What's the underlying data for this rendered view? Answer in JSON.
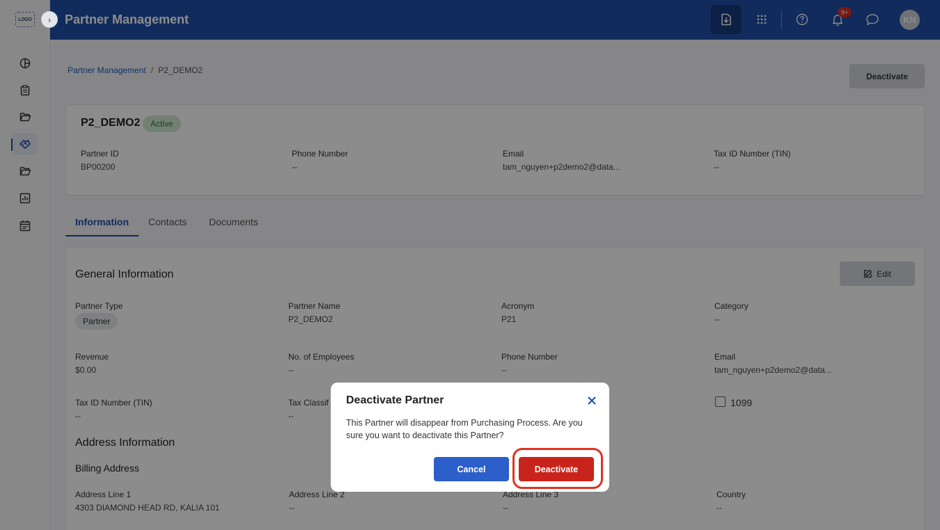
{
  "app": {
    "logo_text": "LOGO",
    "title": "Partner Management",
    "notification_count": "9+",
    "avatar_initials": "KN"
  },
  "sidebar": {
    "items": [
      {
        "icon": "pie-chart-icon"
      },
      {
        "icon": "clipboard-icon"
      },
      {
        "icon": "folder-open-icon"
      },
      {
        "icon": "handshake-icon",
        "active": true
      },
      {
        "icon": "folder-icon"
      },
      {
        "icon": "bar-chart-icon"
      },
      {
        "icon": "calendar-icon"
      }
    ]
  },
  "breadcrumb": {
    "root": "Partner Management",
    "separator": "/",
    "current": "P2_DEMO2"
  },
  "actions": {
    "deactivate_label": "Deactivate"
  },
  "partner": {
    "name": "P2_DEMO2",
    "status": "Active",
    "summary_fields": [
      {
        "label": "Partner ID",
        "value": "BP00200"
      },
      {
        "label": "Phone Number",
        "value": "--"
      },
      {
        "label": "Email",
        "value": "tam_nguyen+p2demo2@data..."
      },
      {
        "label": "Tax ID Number (TIN)",
        "value": "--"
      }
    ]
  },
  "tabs": [
    {
      "label": "Information",
      "active": true
    },
    {
      "label": "Contacts"
    },
    {
      "label": "Documents"
    }
  ],
  "general_info": {
    "title": "General Information",
    "edit_label": "Edit",
    "fields": [
      {
        "label": "Partner Type",
        "value": "Partner"
      },
      {
        "label": "Partner Name",
        "value": "P2_DEMO2"
      },
      {
        "label": "Acronym",
        "value": "P21"
      },
      {
        "label": "Category",
        "value": "--"
      },
      {
        "label": "Revenue",
        "value": "$0.00"
      },
      {
        "label": "No. of Employees",
        "value": "--"
      },
      {
        "label": "Phone Number",
        "value": "--"
      },
      {
        "label": "Email",
        "value": "tam_nguyen+p2demo2@data..."
      },
      {
        "label": "Tax ID Number (TIN)",
        "value": "--"
      },
      {
        "label": "Tax Classif",
        "value": "--"
      },
      {
        "label": "1099"
      }
    ]
  },
  "address_info": {
    "title": "Address Information",
    "billing_title": "Billing Address",
    "fields": [
      {
        "label": "Address Line 1",
        "value": "4303 DIAMOND HEAD RD, KALIA 101"
      },
      {
        "label": "Address Line 2",
        "value": "--"
      },
      {
        "label": "Address Line 3",
        "value": "--"
      },
      {
        "label": "Country",
        "value": "--"
      }
    ]
  },
  "modal": {
    "title": "Deactivate Partner",
    "body": "This Partner will disappear from Purchasing Process. Are you sure you want to deactivate this Partner?",
    "cancel_label": "Cancel",
    "confirm_label": "Deactivate"
  },
  "colors": {
    "header": "#1e4fa8",
    "primary": "#2d5fcb",
    "danger": "#c9241b",
    "highlight_ring": "#e2311f",
    "status_active": "#cfe9cf"
  }
}
